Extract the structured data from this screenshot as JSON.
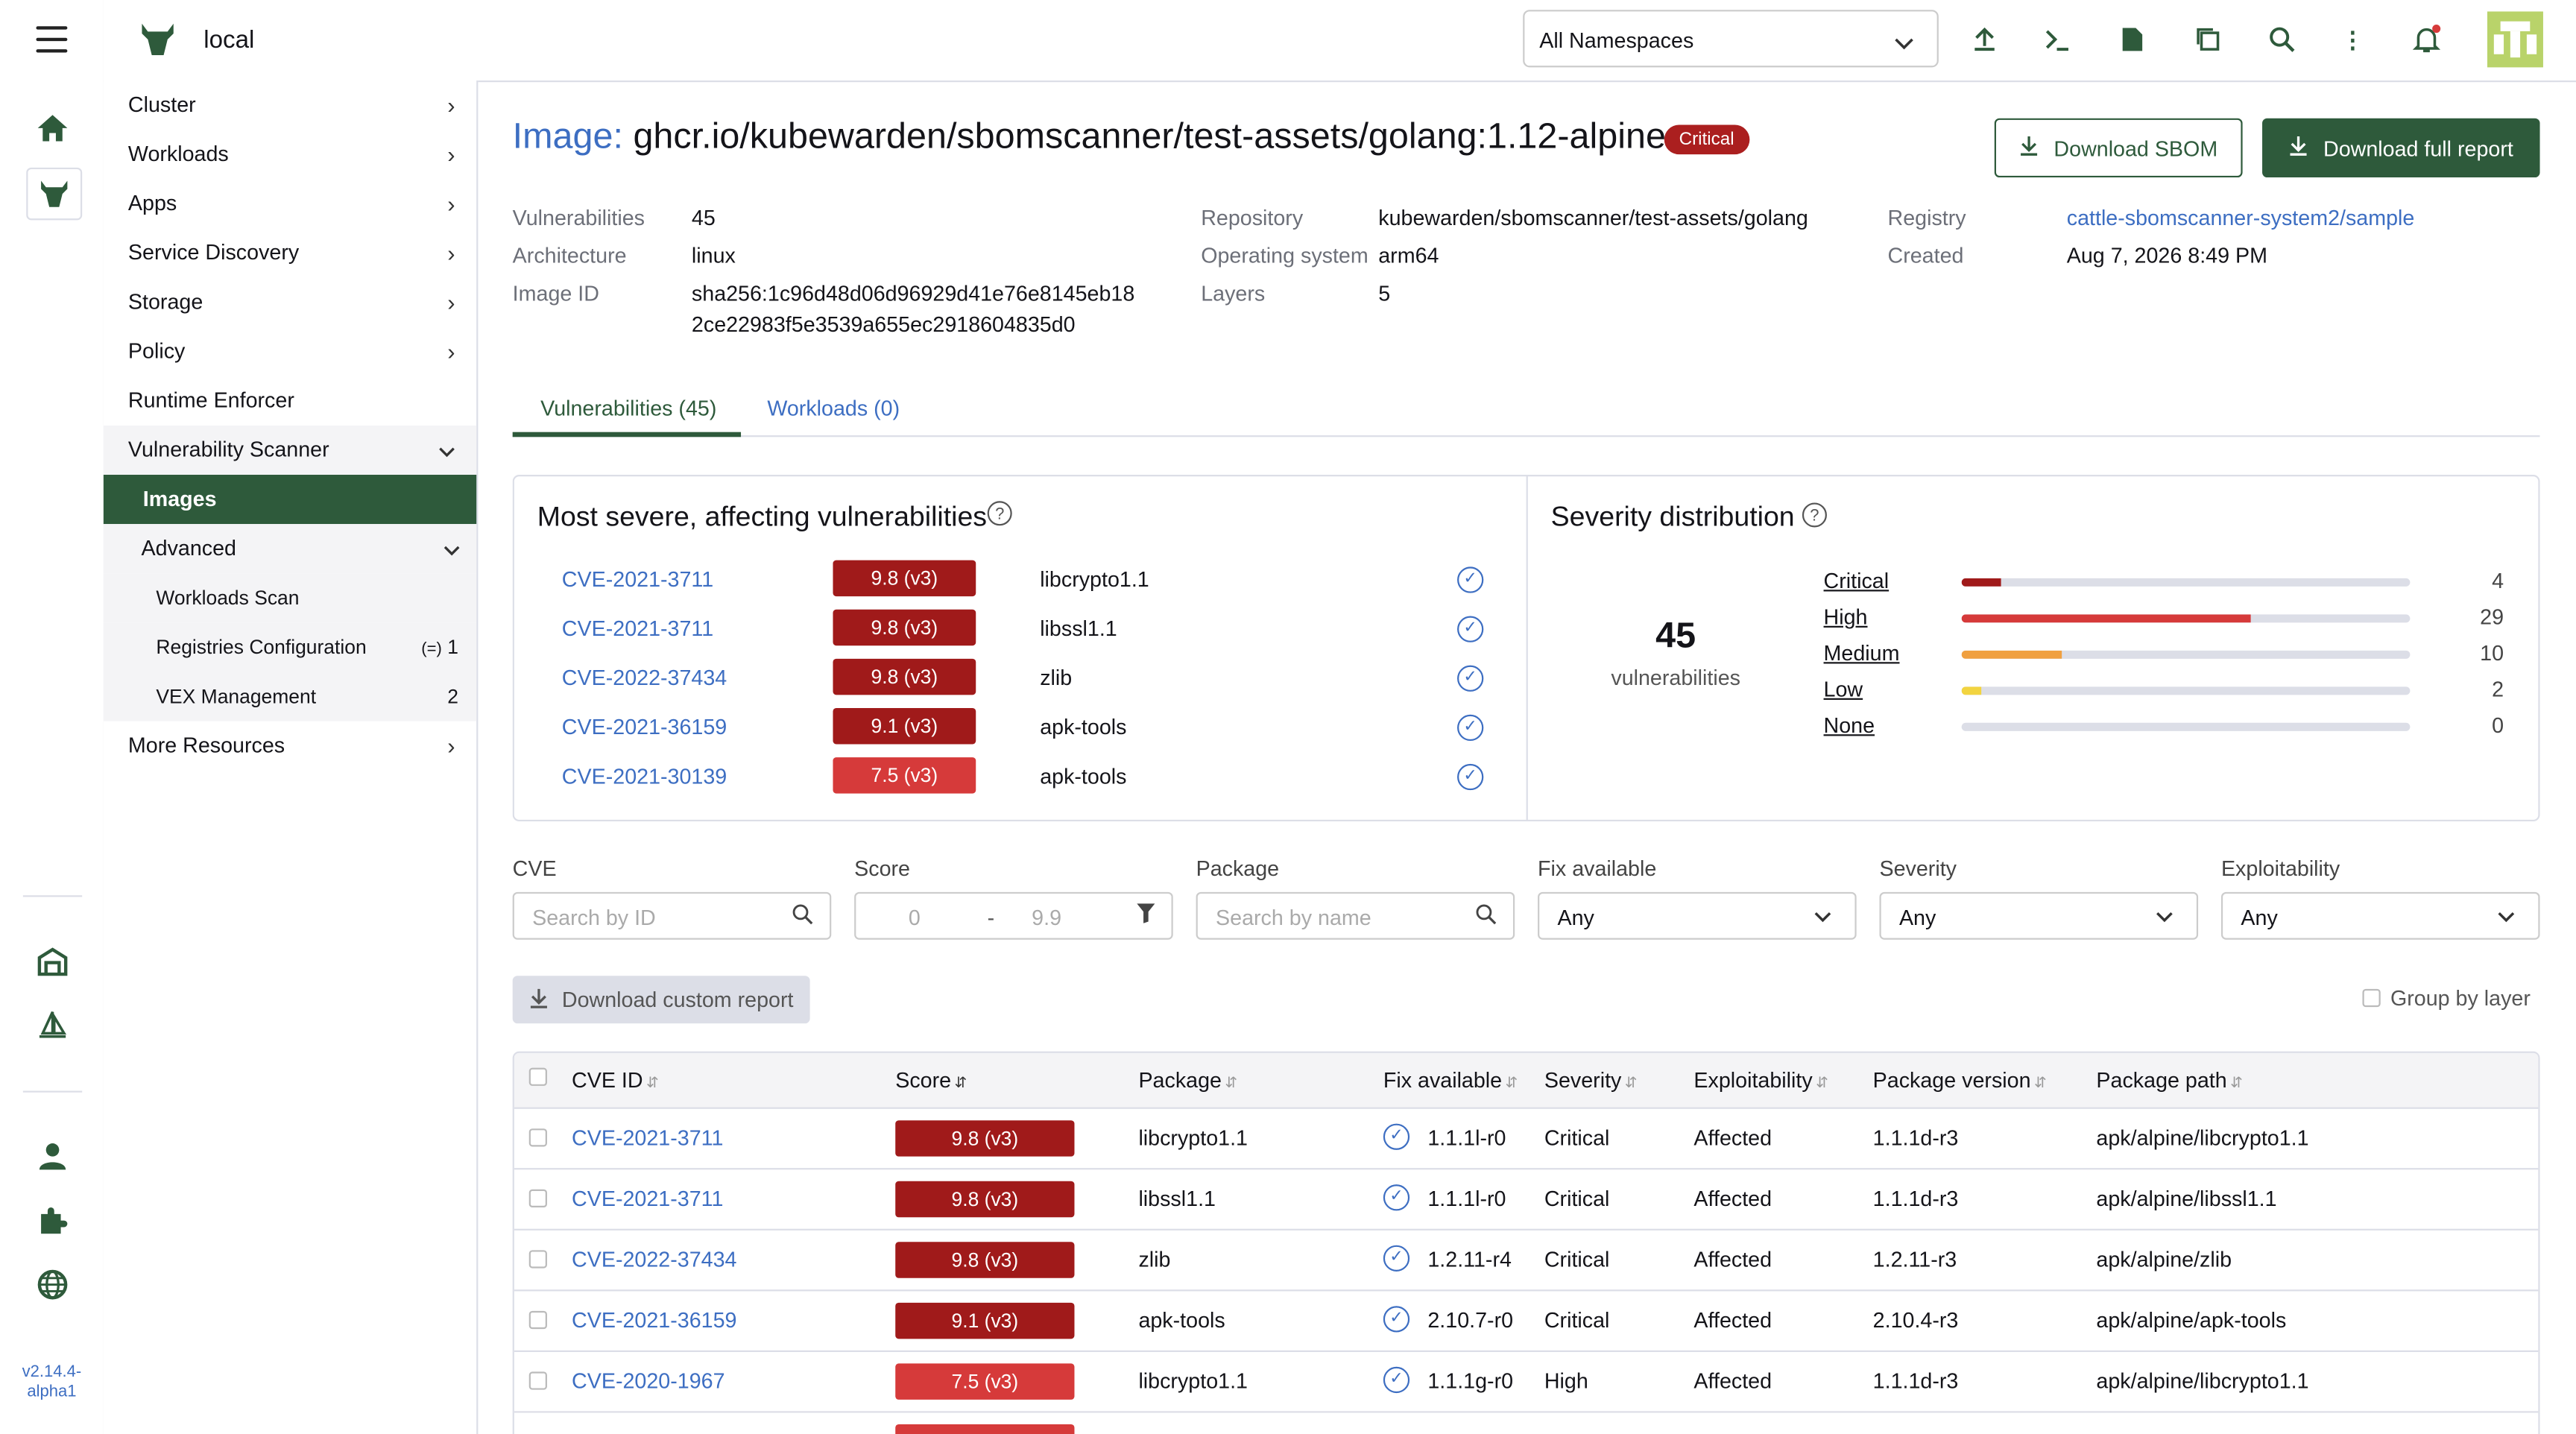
{
  "header": {
    "cluster_name": "local",
    "namespace_select": "All Namespaces",
    "icons": [
      "upload-icon",
      "terminal-icon",
      "file-icon",
      "copy-icon",
      "search-icon",
      "more-icon",
      "bell-icon"
    ]
  },
  "rail": {
    "version": "v2.14.4-alpha1"
  },
  "sidebar": {
    "items": [
      {
        "label": "Cluster"
      },
      {
        "label": "Workloads"
      },
      {
        "label": "Apps"
      },
      {
        "label": "Service Discovery"
      },
      {
        "label": "Storage"
      },
      {
        "label": "Policy"
      },
      {
        "label": "Runtime Enforcer"
      },
      {
        "label": "Vulnerability Scanner"
      },
      {
        "label": "Images"
      },
      {
        "label": "Advanced"
      },
      {
        "label": "Workloads Scan"
      },
      {
        "label": "Registries Configuration",
        "count": "1"
      },
      {
        "label": "VEX Management",
        "count": "2"
      },
      {
        "label": "More Resources"
      }
    ]
  },
  "image": {
    "title_label": "Image:",
    "title_value": "ghcr.io/kubewarden/sbomscanner/test-assets/golang:1.12-alpine",
    "badge": "Critical",
    "download_sbom": "Download SBOM",
    "download_full": "Download full report",
    "meta": {
      "vulnerabilities_k": "Vulnerabilities",
      "vulnerabilities_v": "45",
      "architecture_k": "Architecture",
      "architecture_v": "linux",
      "image_id_k": "Image ID",
      "image_id_v1": "sha256:1c96d48d06d96929d41e76e8145eb18",
      "image_id_v2": "2ce22983f5e3539a655ec2918604835d0",
      "repository_k": "Repository",
      "repository_v": "kubewarden/sbomscanner/test-assets/golang",
      "os_k": "Operating system",
      "os_v": "arm64",
      "layers_k": "Layers",
      "layers_v": "5",
      "registry_k": "Registry",
      "registry_v": "cattle-sbomscanner-system2/sample",
      "created_k": "Created",
      "created_v": "Aug 7, 2026 8:49 PM"
    }
  },
  "tabs": [
    {
      "label": "Vulnerabilities (45)"
    },
    {
      "label": "Workloads (0)"
    }
  ],
  "most_severe": {
    "title": "Most severe, affecting vulnerabilities",
    "rows": [
      {
        "cve": "CVE-2021-3711",
        "score": "9.8 (v3)",
        "package": "libcrypto1.1",
        "color": "#a01a1a"
      },
      {
        "cve": "CVE-2021-3711",
        "score": "9.8 (v3)",
        "package": "libssl1.1",
        "color": "#a01a1a"
      },
      {
        "cve": "CVE-2022-37434",
        "score": "9.8 (v3)",
        "package": "zlib",
        "color": "#a01a1a"
      },
      {
        "cve": "CVE-2021-36159",
        "score": "9.1 (v3)",
        "package": "apk-tools",
        "color": "#a01a1a"
      },
      {
        "cve": "CVE-2021-30139",
        "score": "7.5 (v3)",
        "package": "apk-tools",
        "color": "#d63a3a"
      }
    ]
  },
  "severity_distribution": {
    "title": "Severity distribution",
    "total": "45",
    "total_label": "vulnerabilities",
    "levels": [
      {
        "name": "Critical",
        "count": 4,
        "color": "#a01a1a"
      },
      {
        "name": "High",
        "count": 29,
        "color": "#d63a3a"
      },
      {
        "name": "Medium",
        "count": 10,
        "color": "#f0a040"
      },
      {
        "name": "Low",
        "count": 2,
        "color": "#f2d440"
      },
      {
        "name": "None",
        "count": 0,
        "color": "#999999"
      }
    ]
  },
  "filters": {
    "cve_label": "CVE",
    "cve_placeholder": "Search by ID",
    "score_label": "Score",
    "score_min": "0",
    "score_sep": "-",
    "score_max": "9.9",
    "package_label": "Package",
    "package_placeholder": "Search by name",
    "fix_label": "Fix available",
    "fix_value": "Any",
    "severity_label": "Severity",
    "severity_value": "Any",
    "exploit_label": "Exploitability",
    "exploit_value": "Any"
  },
  "actions": {
    "custom_report": "Download custom report",
    "group_by_layer": "Group by layer"
  },
  "table": {
    "columns": [
      "CVE ID",
      "Score",
      "Package",
      "Fix available",
      "Severity",
      "Exploitability",
      "Package version",
      "Package path"
    ],
    "rows": [
      {
        "cve": "CVE-2021-3711",
        "score": "9.8 (v3)",
        "color": "#a01a1a",
        "package": "libcrypto1.1",
        "fix": "1.1.1l-r0",
        "severity": "Critical",
        "exploitability": "Affected",
        "version": "1.1.1d-r3",
        "path": "apk/alpine/libcrypto1.1"
      },
      {
        "cve": "CVE-2021-3711",
        "score": "9.8 (v3)",
        "color": "#a01a1a",
        "package": "libssl1.1",
        "fix": "1.1.1l-r0",
        "severity": "Critical",
        "exploitability": "Affected",
        "version": "1.1.1d-r3",
        "path": "apk/alpine/libssl1.1"
      },
      {
        "cve": "CVE-2022-37434",
        "score": "9.8 (v3)",
        "color": "#a01a1a",
        "package": "zlib",
        "fix": "1.2.11-r4",
        "severity": "Critical",
        "exploitability": "Affected",
        "version": "1.2.11-r3",
        "path": "apk/alpine/zlib"
      },
      {
        "cve": "CVE-2021-36159",
        "score": "9.1 (v3)",
        "color": "#a01a1a",
        "package": "apk-tools",
        "fix": "2.10.7-r0",
        "severity": "Critical",
        "exploitability": "Affected",
        "version": "2.10.4-r3",
        "path": "apk/alpine/apk-tools"
      },
      {
        "cve": "CVE-2020-1967",
        "score": "7.5 (v3)",
        "color": "#d63a3a",
        "package": "libcrypto1.1",
        "fix": "1.1.1g-r0",
        "severity": "High",
        "exploitability": "Affected",
        "version": "1.1.1d-r3",
        "path": "apk/alpine/libcrypto1.1"
      }
    ]
  }
}
